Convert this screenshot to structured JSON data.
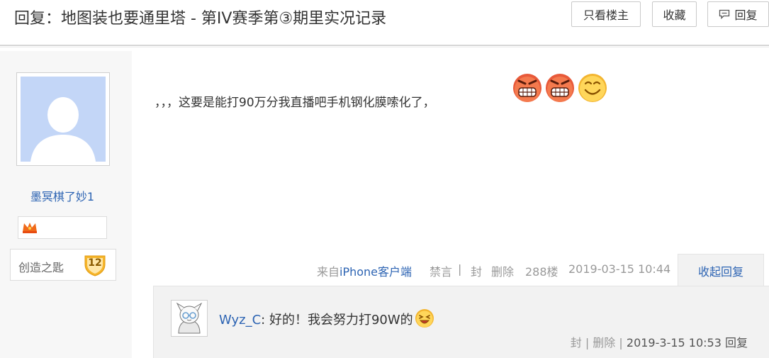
{
  "header": {
    "title": "回复：地图装也要通里塔 - 第IV赛季第③期里实况记录",
    "btn_only_op": "只看楼主",
    "btn_favorite": "收藏",
    "btn_reply": "回复"
  },
  "author": {
    "username": "墨冥棋了妙1",
    "level_name": "创造之匙",
    "level": "12"
  },
  "post": {
    "text": "，，，这要是能打90万分我直播吧手机钢化膜嗦化了，",
    "emojis": [
      "angry-grin-icon",
      "angry-grin-icon",
      "smile-icon"
    ],
    "source_prefix": "来自",
    "source_link": "iPhone客户端",
    "mute": "禁言",
    "sep": "|",
    "ban": "封",
    "delete": "删除",
    "floor": "288楼",
    "time": "2019-03-15 10:44",
    "collapse": "收起回复"
  },
  "subreply": {
    "user": "Wyz_C",
    "colon": ":",
    "text": "好的！我会努力打90W的",
    "emoji": "laugh-icon",
    "ban": "封",
    "sep": "|",
    "delete": "删除",
    "time": "2019-3-15 10:53",
    "reply": "回复"
  },
  "colors": {
    "link": "#2d64b3",
    "muted": "#999999",
    "avatar_bg": "#c3d6f7"
  }
}
